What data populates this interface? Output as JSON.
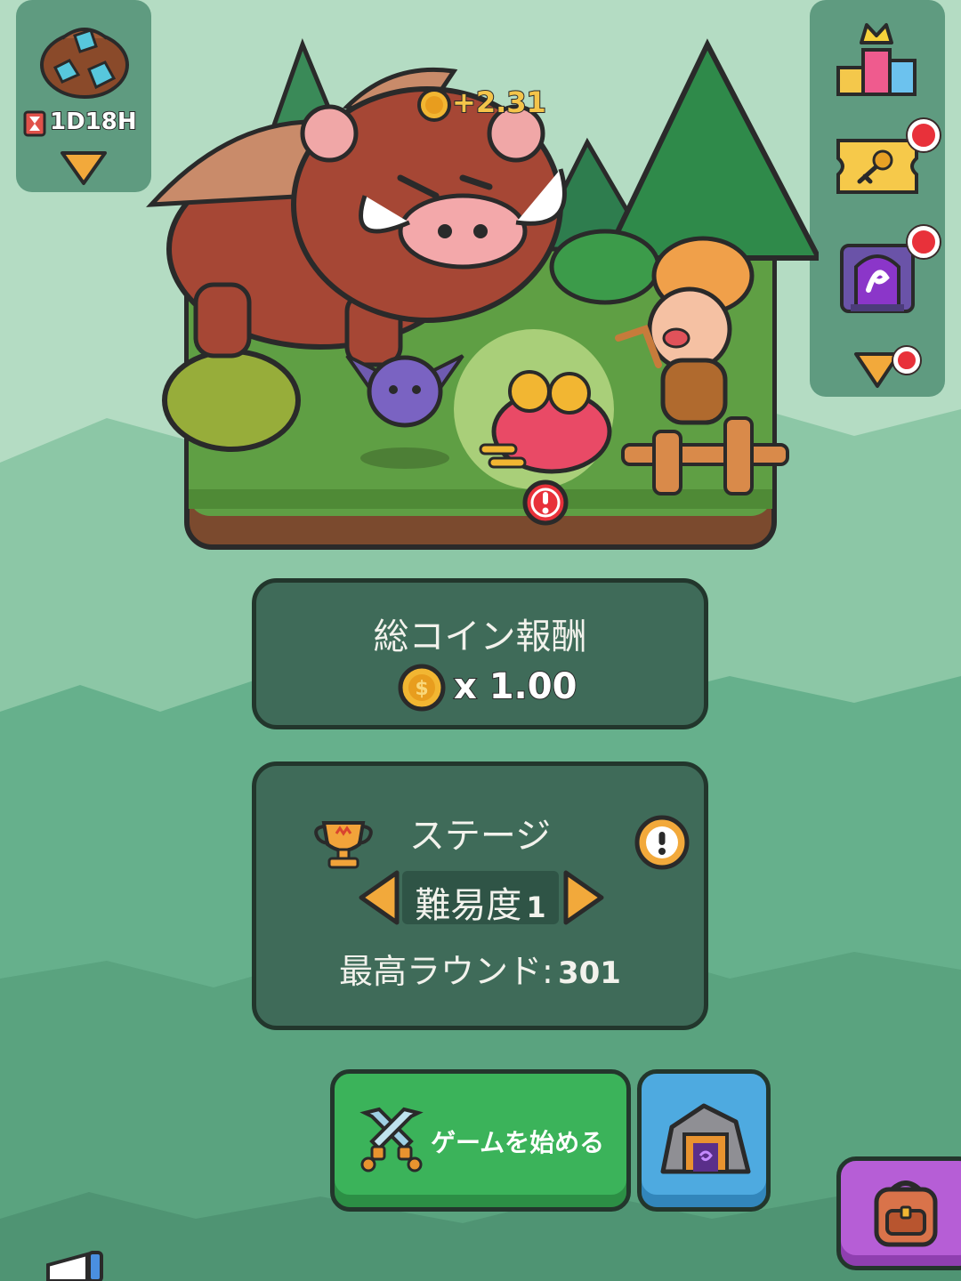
{
  "event": {
    "timer": "1D18H"
  },
  "scene": {
    "coin_gain": "+2.31"
  },
  "reward_panel": {
    "title": "総コイン報酬",
    "multiplier": "x 1.00"
  },
  "stage_panel": {
    "title": "ステージ",
    "difficulty_label": "難易度",
    "difficulty_value": "1",
    "best_round_label": "最高ラウンド:",
    "best_round_value": "301"
  },
  "buttons": {
    "start_game": "ゲームを始める"
  },
  "colors": {
    "start_button": "#3bb35a",
    "dungeon_button": "#4eaae0",
    "bag_button": "#b65ed6",
    "alert_red": "#e8313a"
  }
}
